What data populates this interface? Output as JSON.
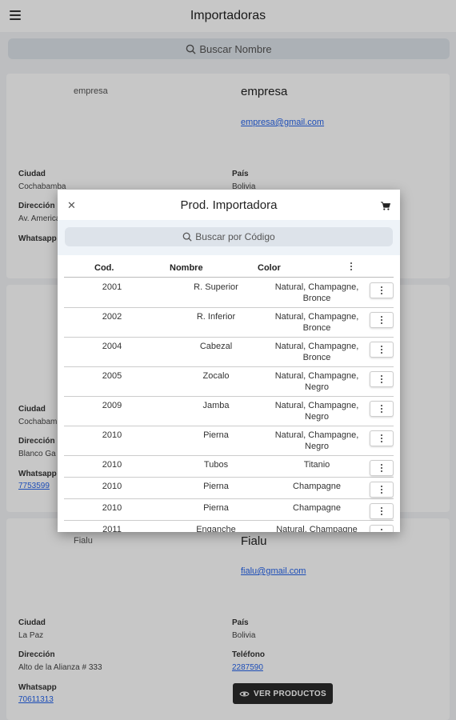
{
  "appbar": {
    "title": "Importadoras"
  },
  "search": {
    "placeholder": "Buscar Nombre"
  },
  "cards": [
    {
      "img_alt": "empresa",
      "name": "empresa",
      "email": "empresa@gmail.com",
      "ciudad_label": "Ciudad",
      "ciudad": "Cochabamba",
      "pais_label": "País",
      "pais": "Bolivia",
      "direccion_label": "Dirección",
      "direccion": "Av. America",
      "whatsapp_label": "Whatsapp"
    },
    {
      "ciudad_label": "Ciudad",
      "ciudad": "Cochabam",
      "direccion_label": "Dirección",
      "direccion": "Blanco Ga",
      "whatsapp_label": "Whatsapp",
      "whatsapp": "7753599"
    },
    {
      "img_alt": "Fialu",
      "name": "Fialu",
      "email": "fialu@gmail.com",
      "ciudad_label": "Ciudad",
      "ciudad": "La Paz",
      "pais_label": "País",
      "pais": "Bolivia",
      "direccion_label": "Dirección",
      "direccion": "Alto de la Alianza # 333",
      "telefono_label": "Teléfono",
      "telefono": "2287590",
      "whatsapp_label": "Whatsapp",
      "whatsapp": "70611313",
      "ver_productos": "VER PRODUCTOS"
    }
  ],
  "modal": {
    "title": "Prod. Importadora",
    "search_placeholder": "Buscar por Código",
    "headers": {
      "cod": "Cod.",
      "nombre": "Nombre",
      "color": "Color"
    },
    "rows": [
      {
        "cod": "2001",
        "nombre": "R. Superior",
        "color": "Natural, Champagne, Bronce"
      },
      {
        "cod": "2002",
        "nombre": "R. Inferior",
        "color": "Natural, Champagne, Bronce"
      },
      {
        "cod": "2004",
        "nombre": "Cabezal",
        "color": "Natural, Champagne, Bronce"
      },
      {
        "cod": "2005",
        "nombre": "Zocalo",
        "color": "Natural, Champagne, Negro"
      },
      {
        "cod": "2009",
        "nombre": "Jamba",
        "color": "Natural, Champagne, Negro"
      },
      {
        "cod": "2010",
        "nombre": "Pierna",
        "color": "Natural, Champagne, Negro"
      },
      {
        "cod": "2010",
        "nombre": "Tubos",
        "color": "Titanio"
      },
      {
        "cod": "2010",
        "nombre": "Pierna",
        "color": "Champagne"
      },
      {
        "cod": "2010",
        "nombre": "Pierna",
        "color": "Champagne"
      },
      {
        "cod": "2011",
        "nombre": "Enganche",
        "color": "Natural, Champagne"
      }
    ]
  }
}
